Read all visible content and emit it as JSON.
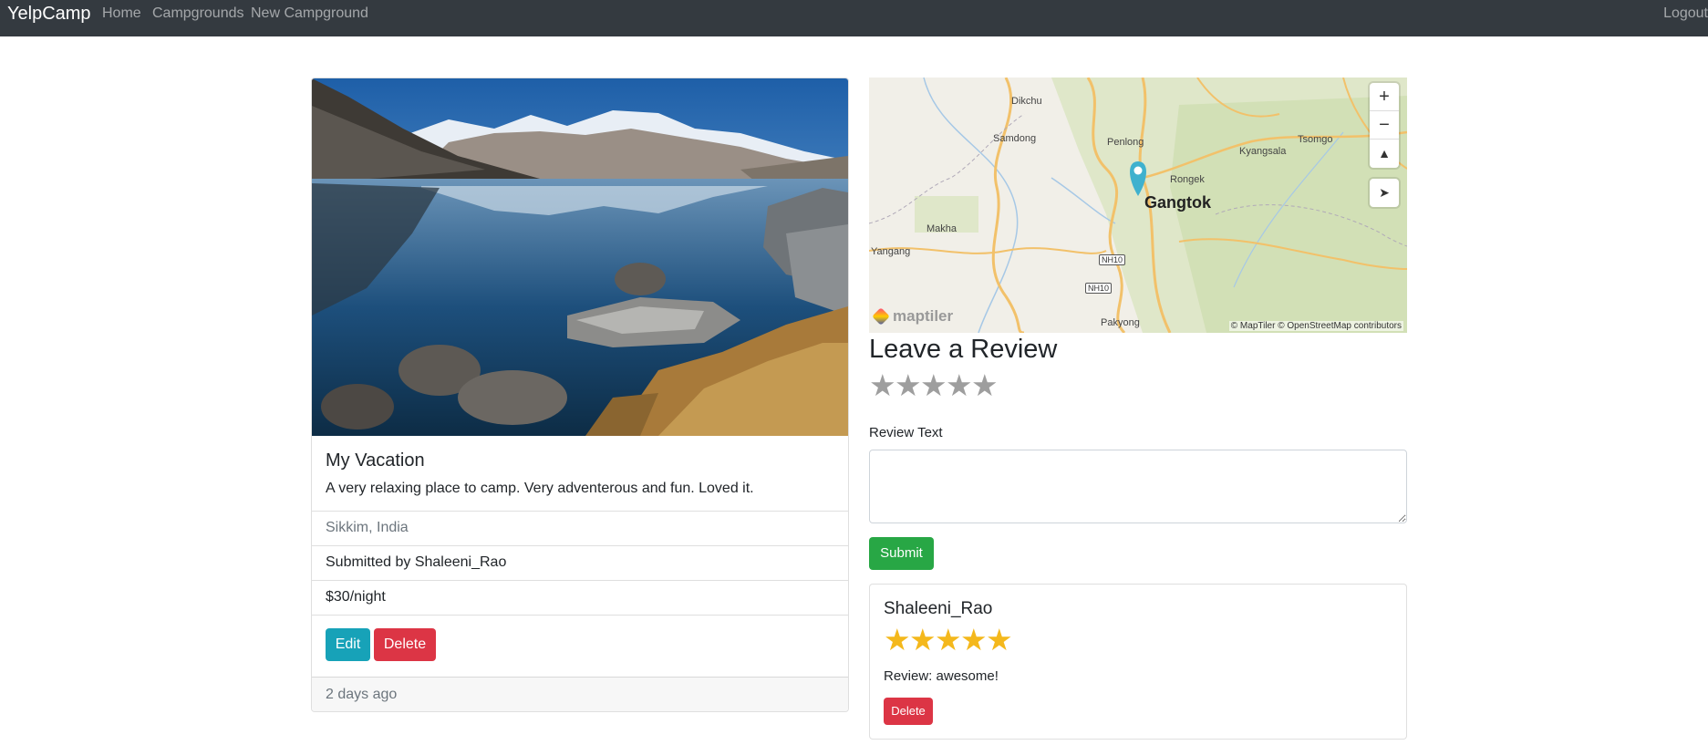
{
  "navbar": {
    "brand": "YelpCamp",
    "links": {
      "home": "Home",
      "campgrounds": "Campgrounds",
      "new_campground": "New Campground",
      "logout": "Logout"
    }
  },
  "campground": {
    "title": "My Vacation",
    "description": "A very relaxing place to camp. Very adventerous and fun. Loved it.",
    "location": "Sikkim, India",
    "author_line": "Submitted by Shaleeni_Rao",
    "price": "$30/night",
    "edit_label": "Edit",
    "delete_label": "Delete",
    "footer": "2 days ago"
  },
  "map": {
    "city": "Gangtok",
    "labels": [
      "Dikchu",
      "Samdong",
      "Penlong",
      "Tsomgo",
      "Kyangsala",
      "Rongek",
      "Makha",
      "Yangang",
      "Pakyong"
    ],
    "road_badges": [
      "NH10",
      "NH10"
    ],
    "attribution": "© MapTiler © OpenStreetMap contributors",
    "logo": "maptiler",
    "controls": {
      "zoom_in": "+",
      "zoom_out": "−"
    }
  },
  "review_form": {
    "heading": "Leave a Review",
    "rating_stars": [
      "★",
      "★",
      "★",
      "★",
      "★"
    ],
    "text_label": "Review Text",
    "submit_label": "Submit"
  },
  "reviews": [
    {
      "author": "Shaleeni_Rao",
      "rating": 5,
      "stars": [
        "★",
        "★",
        "★",
        "★",
        "★"
      ],
      "text": "Review: awesome!",
      "delete_label": "Delete"
    }
  ],
  "colors": {
    "navbar_bg": "#343a40",
    "edit_btn": "#17a2b8",
    "delete_btn": "#dc3545",
    "submit_btn": "#28a745",
    "star_filled": "#f4b81c",
    "star_empty": "#9e9e9e"
  }
}
